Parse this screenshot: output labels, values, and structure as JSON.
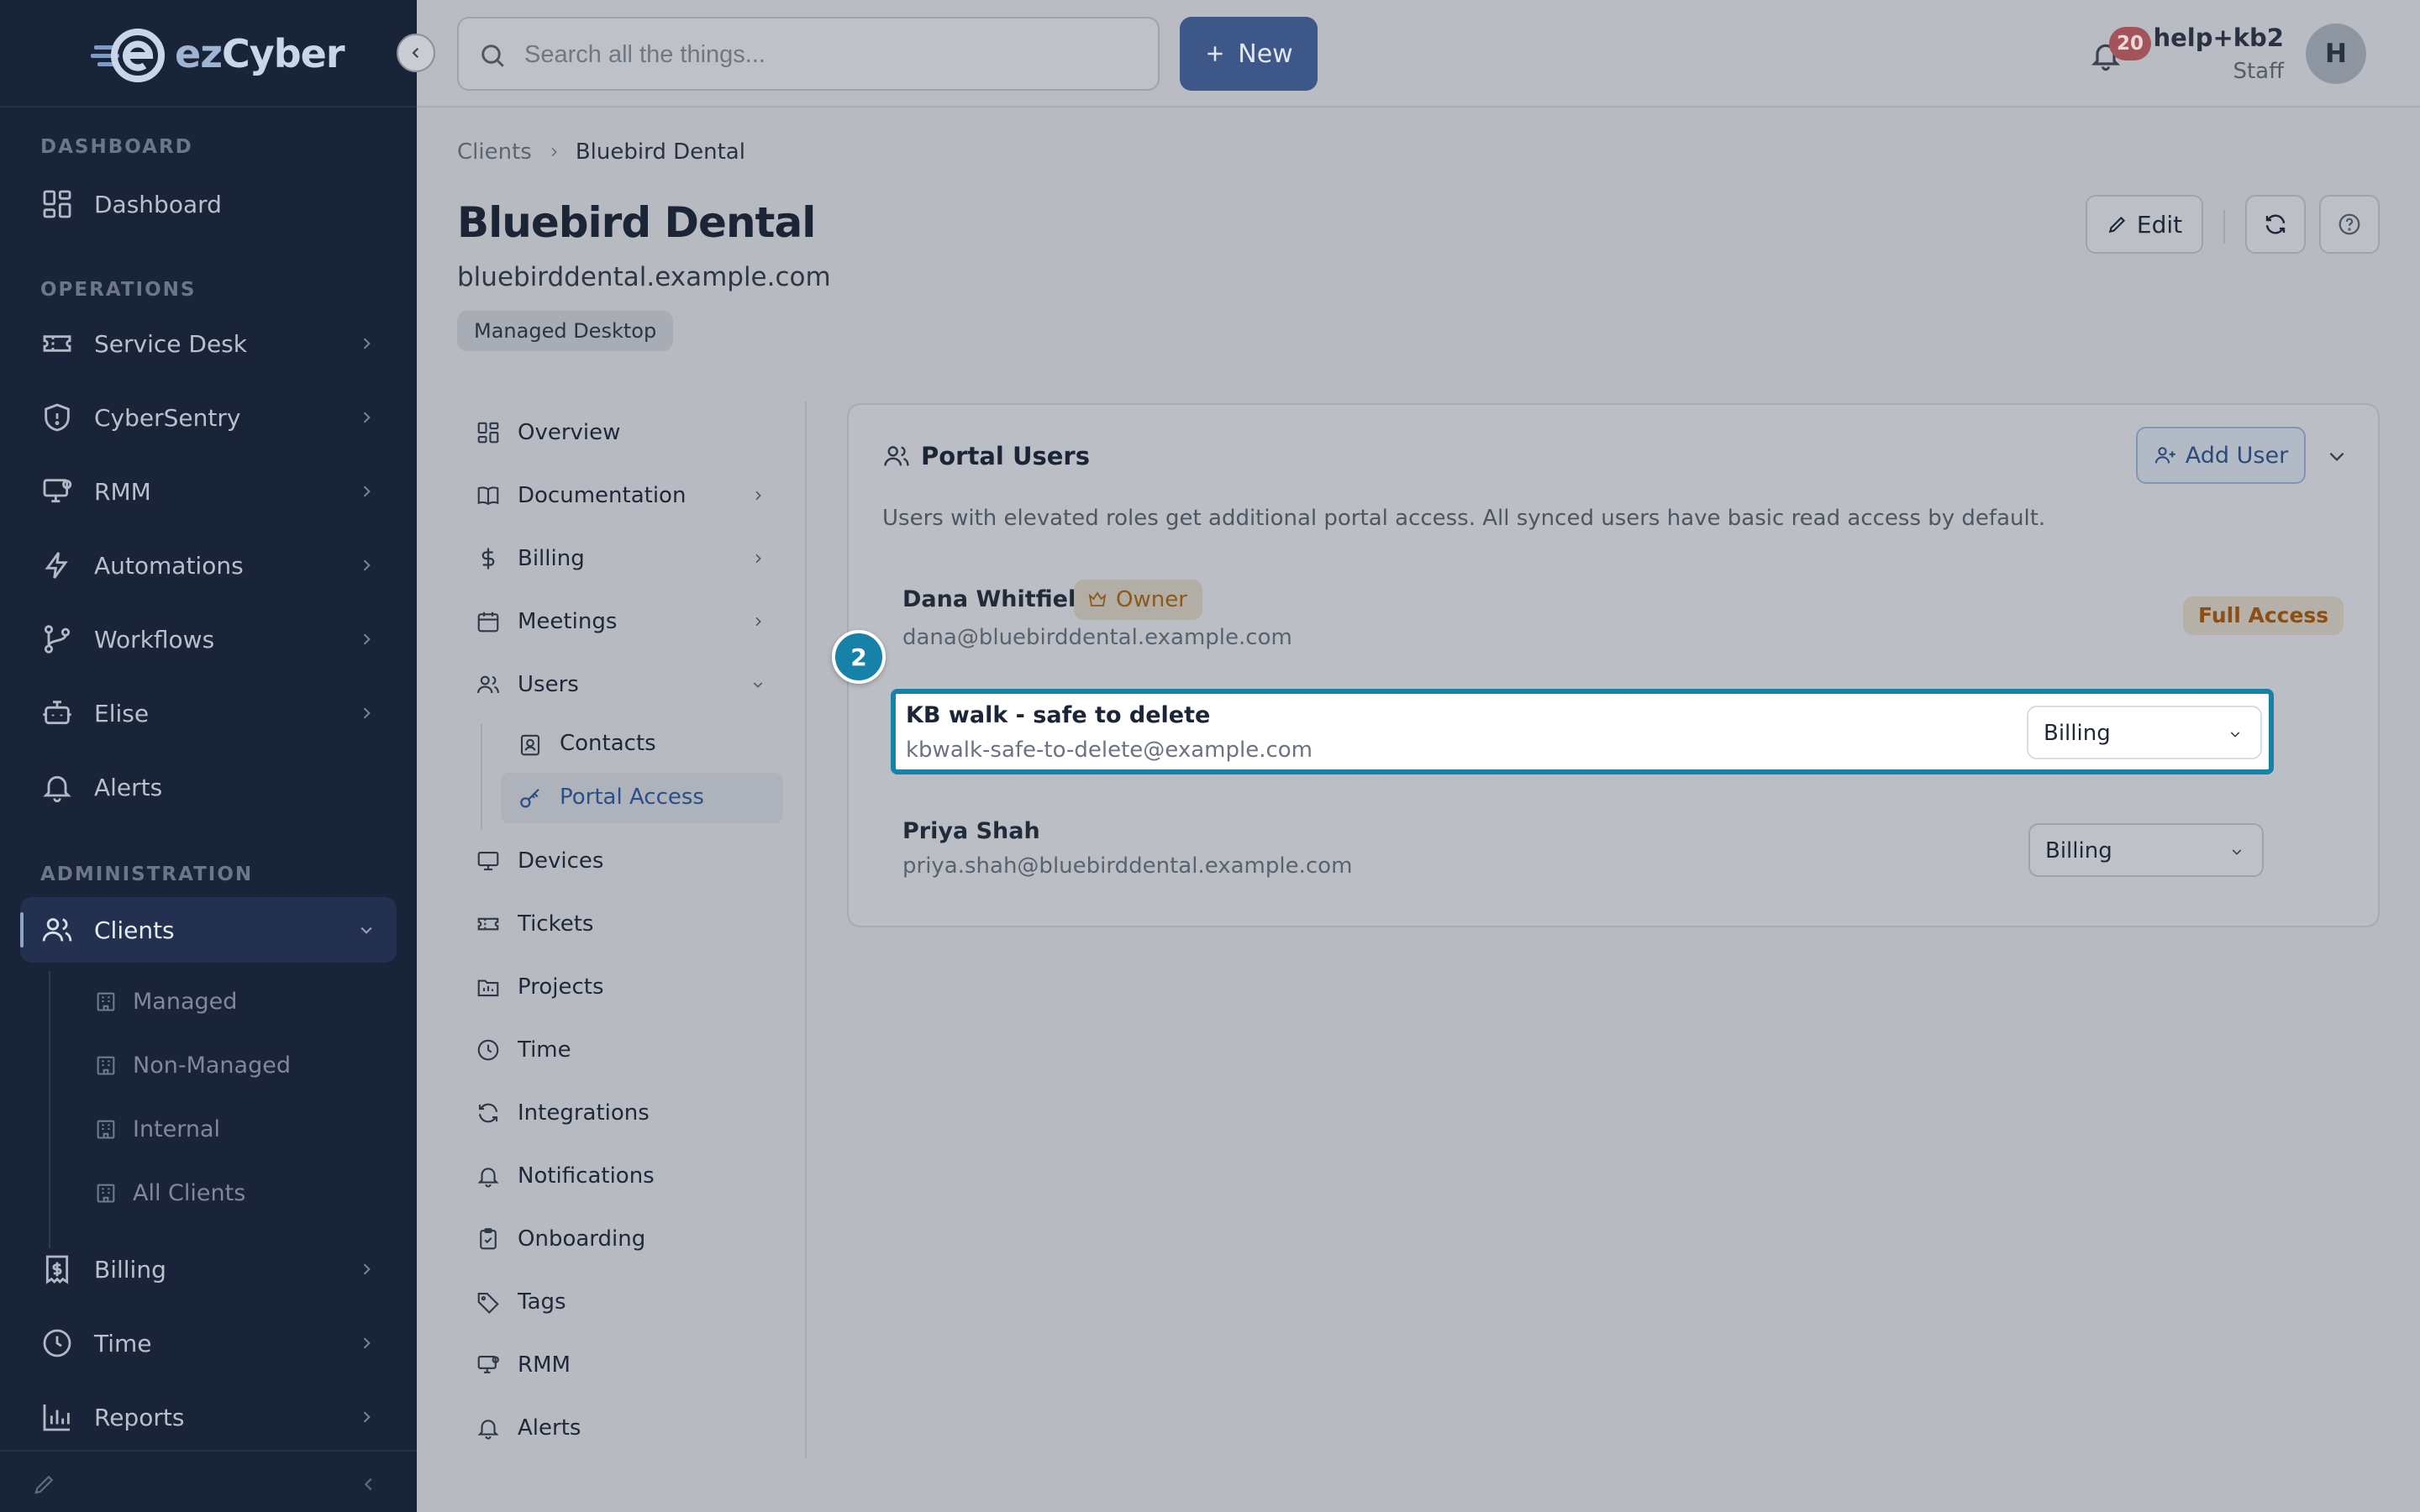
{
  "sidebar": {
    "logo_text_a": "ez",
    "logo_text_b": "Cyber",
    "sections": {
      "dashboard": "DASHBOARD",
      "operations": "OPERATIONS",
      "administration": "ADMINISTRATION"
    },
    "items": {
      "dashboard": "Dashboard",
      "service_desk": "Service Desk",
      "cybersentry": "CyberSentry",
      "rmm": "RMM",
      "automations": "Automations",
      "workflows": "Workflows",
      "elise": "Elise",
      "alerts": "Alerts",
      "clients": "Clients",
      "billing": "Billing",
      "time": "Time",
      "reports": "Reports"
    },
    "clients_sub": {
      "managed": "Managed",
      "non_managed": "Non-Managed",
      "internal": "Internal",
      "all": "All Clients"
    }
  },
  "topbar": {
    "search_placeholder": "Search all the things...",
    "new_label": "New",
    "notif_count": "20",
    "user_name": "help+kb2",
    "user_role": "Staff",
    "avatar_initial": "H"
  },
  "breadcrumb": {
    "root": "Clients",
    "current": "Bluebird Dental"
  },
  "client": {
    "name": "Bluebird Dental",
    "domain": "bluebirddental.example.com",
    "tag": "Managed Desktop",
    "edit_label": "Edit"
  },
  "subnav": {
    "overview": "Overview",
    "documentation": "Documentation",
    "billing": "Billing",
    "meetings": "Meetings",
    "users": "Users",
    "contacts": "Contacts",
    "portal_access": "Portal Access",
    "devices": "Devices",
    "tickets": "Tickets",
    "projects": "Projects",
    "time": "Time",
    "integrations": "Integrations",
    "notifications": "Notifications",
    "onboarding": "Onboarding",
    "tags": "Tags",
    "rmm": "RMM",
    "alerts": "Alerts"
  },
  "portal_users": {
    "title": "Portal Users",
    "add_user_label": "Add User",
    "description": "Users with elevated roles get additional portal access. All synced users have basic read access by default.",
    "users": [
      {
        "name": "Dana Whitfield",
        "badge": "Owner",
        "email": "dana@bluebirddental.example.com",
        "access": "Full Access"
      },
      {
        "name": "KB walk - safe to delete",
        "email": "kbwalk-safe-to-delete@example.com",
        "role": "Billing"
      },
      {
        "name": "Priya Shah",
        "email": "priya.shah@bluebirddental.example.com",
        "role": "Billing"
      }
    ]
  },
  "step_marker": "2",
  "colors": {
    "sidebar_bg": "#1a2438",
    "accent": "#3d5789",
    "highlight": "#1682a8",
    "owner": "#8a5a1c"
  }
}
